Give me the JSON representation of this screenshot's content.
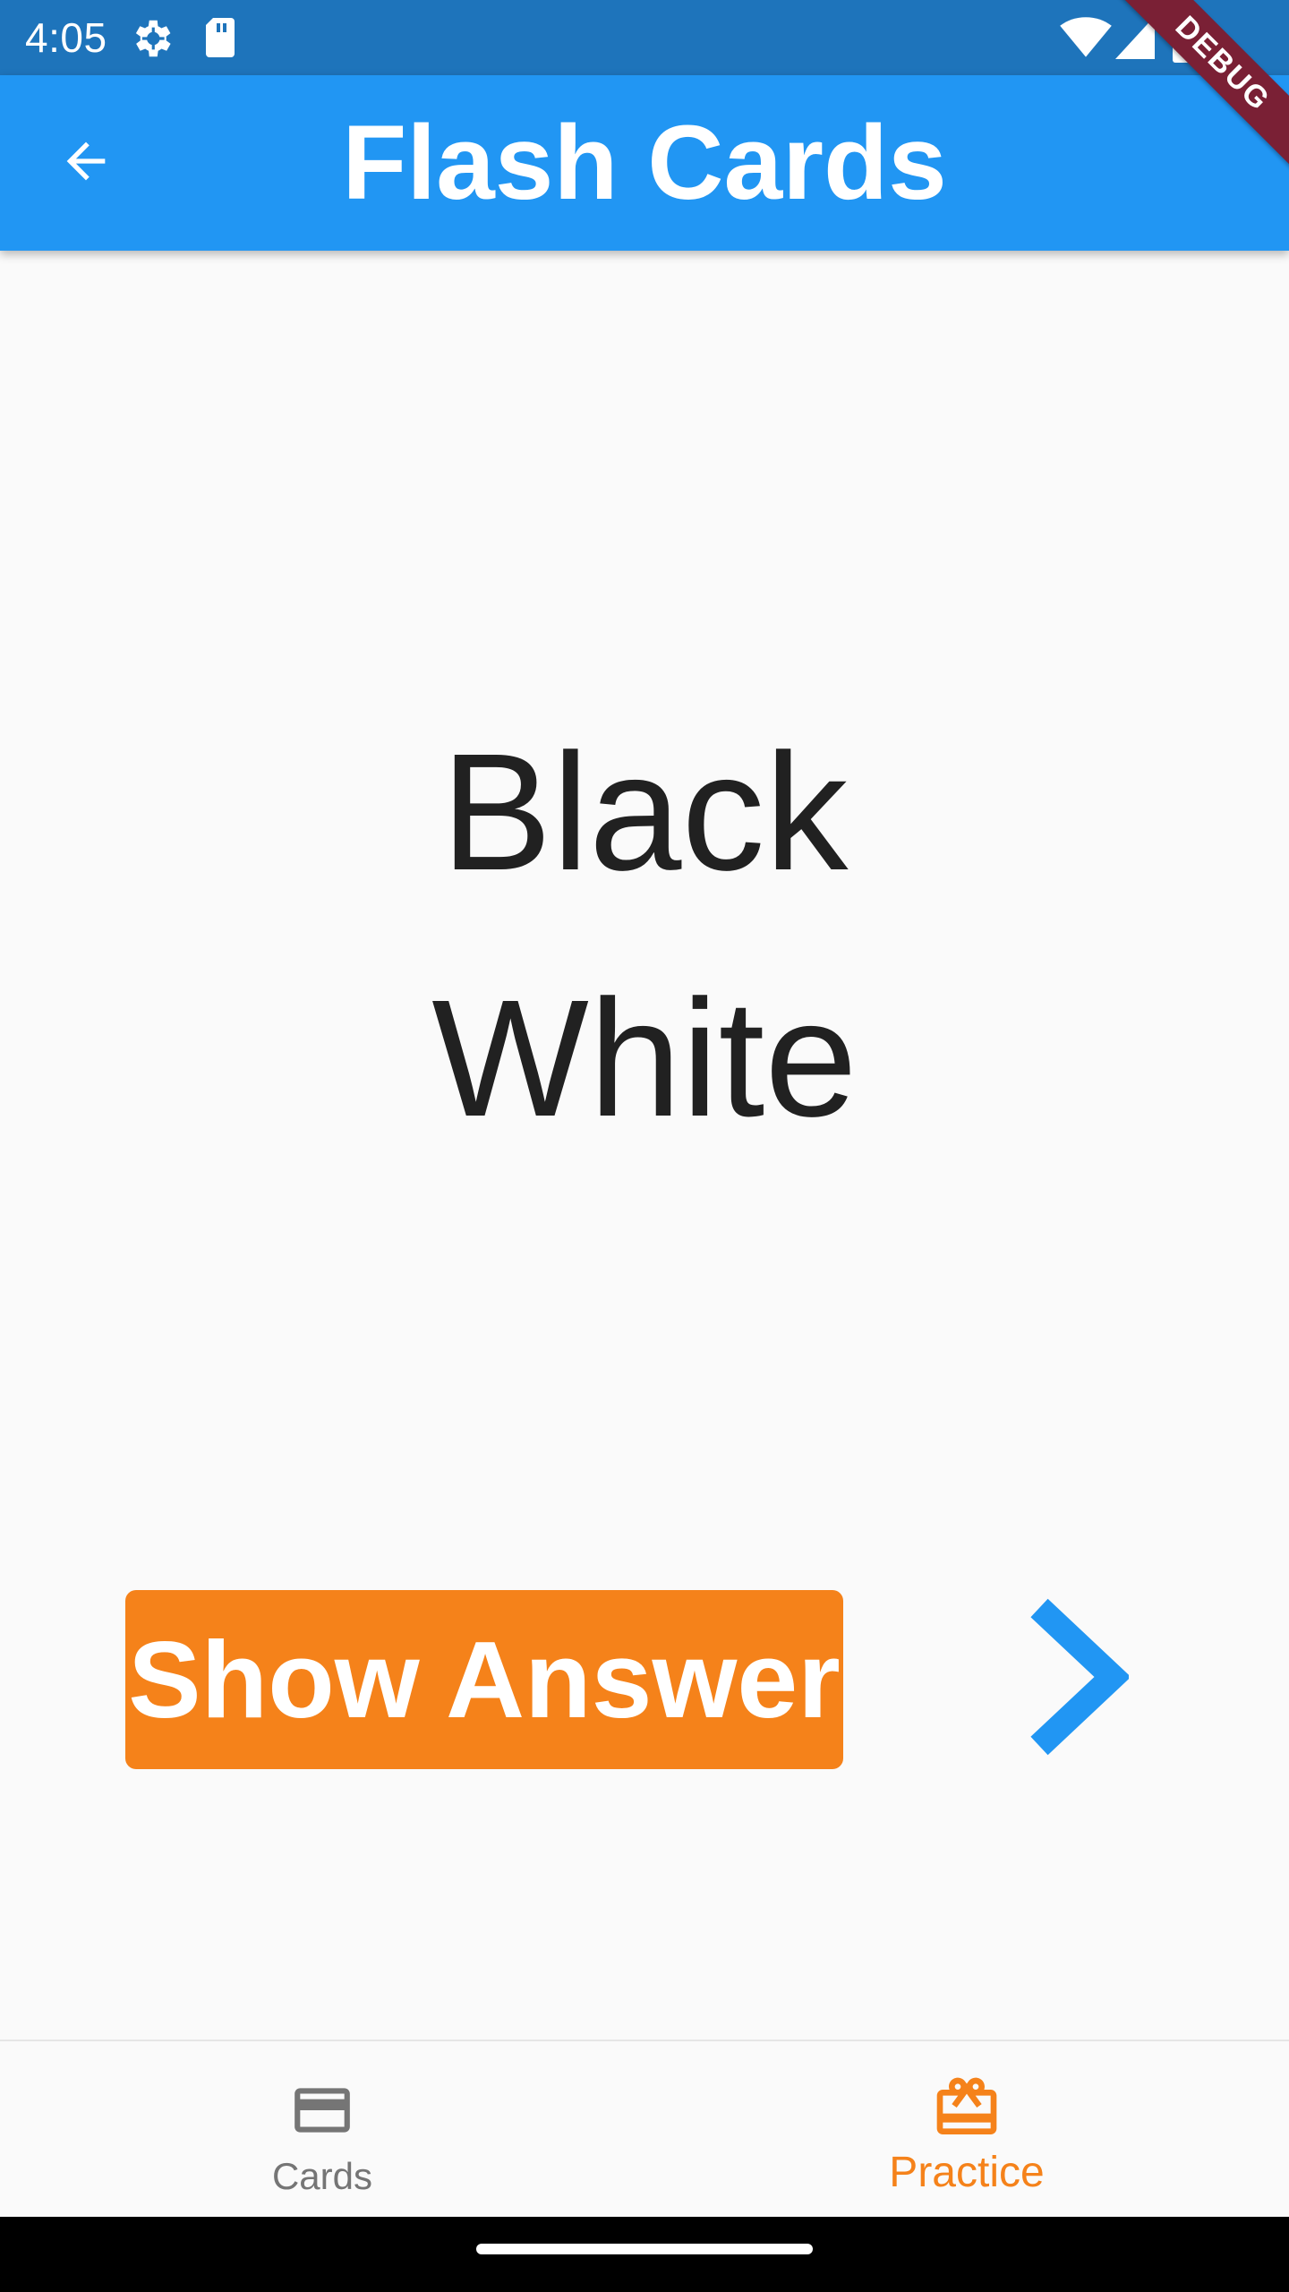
{
  "status_bar": {
    "time": "4:05",
    "icons": [
      "settings-gear-icon",
      "sd-card-icon",
      "wifi-icon",
      "cell-signal-icon",
      "battery-icon"
    ],
    "background": "#1e74bb"
  },
  "app_bar": {
    "title": "Flash Cards",
    "back_icon": "arrow-back-icon",
    "background": "#2196f3"
  },
  "debug_banner": {
    "label": "DEBUG",
    "color": "#7a2035"
  },
  "card": {
    "front": "Black",
    "back": "White"
  },
  "actions": {
    "show_answer_label": "Show Answer",
    "show_answer_color": "#f5821a",
    "next_icon": "chevron-right-icon",
    "next_color": "#2196f3"
  },
  "bottom_nav": {
    "items": [
      {
        "label": "Cards",
        "icon": "credit-card-icon",
        "selected": false,
        "color": "#757575"
      },
      {
        "label": "Practice",
        "icon": "card-giftcard-icon",
        "selected": true,
        "color": "#f5821a"
      }
    ]
  }
}
